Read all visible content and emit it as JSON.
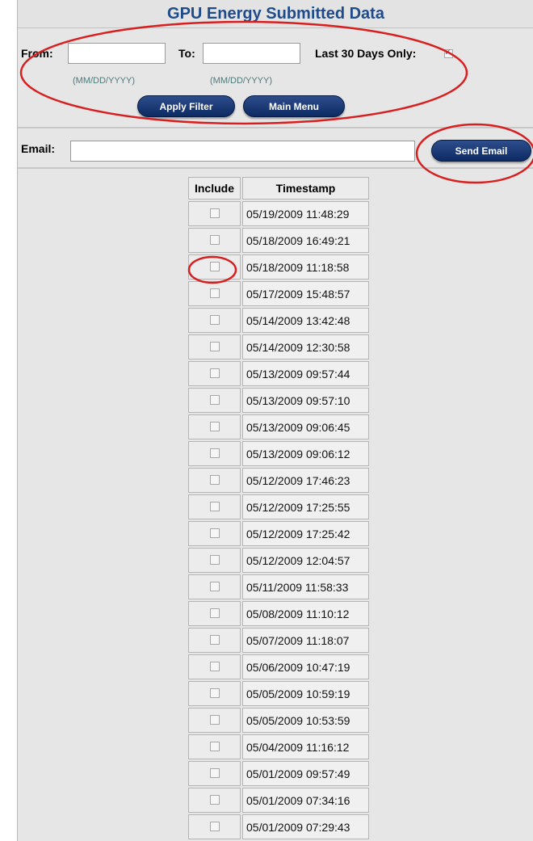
{
  "header": {
    "title": "GPU Energy Submitted Data"
  },
  "filter": {
    "from_label": "From:",
    "to_label": "To:",
    "from_value": "",
    "to_value": "",
    "date_hint": "(MM/DD/YYYY)",
    "last30_label": "Last 30 Days Only:",
    "last30_checked": true,
    "apply_label": "Apply Filter",
    "main_menu_label": "Main Menu"
  },
  "email": {
    "label": "Email:",
    "value": "",
    "send_label": "Send Email"
  },
  "table": {
    "columns": [
      "Include",
      "Timestamp"
    ],
    "rows": [
      {
        "timestamp": "05/19/2009 11:48:29",
        "include": false
      },
      {
        "timestamp": "05/18/2009 16:49:21",
        "include": false
      },
      {
        "timestamp": "05/18/2009 11:18:58",
        "include": false
      },
      {
        "timestamp": "05/17/2009 15:48:57",
        "include": false
      },
      {
        "timestamp": "05/14/2009 13:42:48",
        "include": false
      },
      {
        "timestamp": "05/14/2009 12:30:58",
        "include": false
      },
      {
        "timestamp": "05/13/2009 09:57:44",
        "include": false
      },
      {
        "timestamp": "05/13/2009 09:57:10",
        "include": false
      },
      {
        "timestamp": "05/13/2009 09:06:45",
        "include": false
      },
      {
        "timestamp": "05/13/2009 09:06:12",
        "include": false
      },
      {
        "timestamp": "05/12/2009 17:46:23",
        "include": false
      },
      {
        "timestamp": "05/12/2009 17:25:55",
        "include": false
      },
      {
        "timestamp": "05/12/2009 17:25:42",
        "include": false
      },
      {
        "timestamp": "05/12/2009 12:04:57",
        "include": false
      },
      {
        "timestamp": "05/11/2009 11:58:33",
        "include": false
      },
      {
        "timestamp": "05/08/2009 11:10:12",
        "include": false
      },
      {
        "timestamp": "05/07/2009 11:18:07",
        "include": false
      },
      {
        "timestamp": "05/06/2009 10:47:19",
        "include": false
      },
      {
        "timestamp": "05/05/2009 10:59:19",
        "include": false
      },
      {
        "timestamp": "05/05/2009 10:53:59",
        "include": false
      },
      {
        "timestamp": "05/04/2009 11:16:12",
        "include": false
      },
      {
        "timestamp": "05/01/2009 09:57:49",
        "include": false
      },
      {
        "timestamp": "05/01/2009 07:34:16",
        "include": false
      },
      {
        "timestamp": "05/01/2009 07:29:43",
        "include": false
      },
      {
        "timestamp": "",
        "include": false
      }
    ]
  },
  "colors": {
    "title_text": "#1f4b8a",
    "button_fill": "#0d2a63",
    "annotation": "#d81f1f",
    "panel_bg": "#e6e6e6"
  },
  "icons": {
    "checkbox_checked": "checkbox-checked-icon"
  }
}
